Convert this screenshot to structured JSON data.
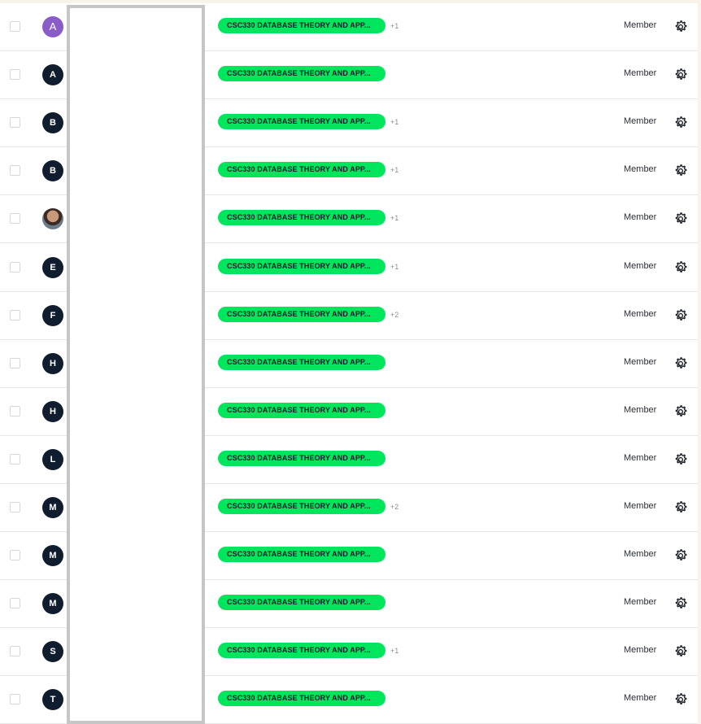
{
  "tag_label": "CSC330 DATABASE THEORY AND APP...",
  "role_label": "Member",
  "rows": [
    {
      "initial": "A",
      "avatar": "purple",
      "extra": "+1"
    },
    {
      "initial": "A",
      "avatar": "dark",
      "extra": ""
    },
    {
      "initial": "B",
      "avatar": "dark",
      "extra": "+1"
    },
    {
      "initial": "B",
      "avatar": "dark",
      "extra": "+1"
    },
    {
      "initial": "",
      "avatar": "photo",
      "extra": "+1"
    },
    {
      "initial": "E",
      "avatar": "dark",
      "extra": "+1"
    },
    {
      "initial": "F",
      "avatar": "dark",
      "extra": "+2"
    },
    {
      "initial": "H",
      "avatar": "dark",
      "extra": ""
    },
    {
      "initial": "H",
      "avatar": "dark",
      "extra": ""
    },
    {
      "initial": "L",
      "avatar": "dark",
      "extra": ""
    },
    {
      "initial": "M",
      "avatar": "dark",
      "extra": "+2"
    },
    {
      "initial": "M",
      "avatar": "dark",
      "extra": ""
    },
    {
      "initial": "M",
      "avatar": "dark",
      "extra": ""
    },
    {
      "initial": "S",
      "avatar": "dark",
      "extra": "+1"
    },
    {
      "initial": "T",
      "avatar": "dark",
      "extra": ""
    }
  ],
  "colors": {
    "tag_bg": "#00e65c",
    "avatar_dark": "#0f1d2e",
    "avatar_purple": "#8a5cc8"
  },
  "icons": {
    "settings": "gear-icon",
    "checkbox": "checkbox-icon"
  }
}
